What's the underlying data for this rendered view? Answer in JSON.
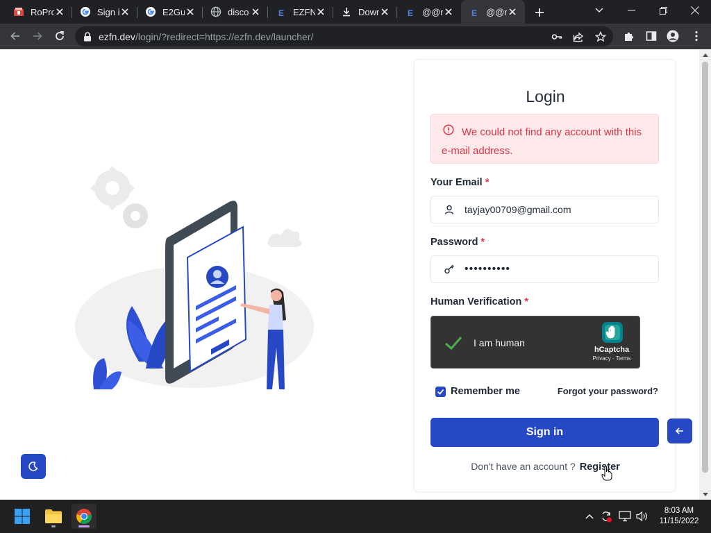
{
  "browser": {
    "tabs": [
      {
        "title": "RoPro",
        "icon": "ropro-icon"
      },
      {
        "title": "Sign i",
        "icon": "google-icon"
      },
      {
        "title": "E2Gu",
        "icon": "google-icon"
      },
      {
        "title": "disco",
        "icon": "globe-icon"
      },
      {
        "title": "EZFN",
        "icon": "ezfn-icon"
      },
      {
        "title": "Down",
        "icon": "download-icon"
      },
      {
        "title": "@@n",
        "icon": "ezfn-icon"
      },
      {
        "title": "@@n",
        "icon": "ezfn-icon",
        "active": true
      }
    ],
    "url_host": "ezfn.dev",
    "url_path": "/login/?redirect=https://ezfn.dev/launcher/"
  },
  "login": {
    "title": "Login",
    "alert": "We could not find any account with this e-mail address.",
    "email_label": "Your Email",
    "email_value": "tayjay00709@gmail.com",
    "password_label": "Password",
    "password_value": "••••••••••",
    "captcha_label": "Human Verification",
    "captcha_text": "I am human",
    "captcha_brand": "hCaptcha",
    "captcha_links": "Privacy - Terms",
    "required_mark": "*",
    "remember_label": "Remember me",
    "remember_checked": true,
    "forgot_label": "Forgot your password?",
    "signin_label": "Sign in",
    "no_account_text": "Don't have an account ?",
    "register_label": "Register"
  },
  "colors": {
    "primary": "#2748c4",
    "alert_bg": "#fde8ea",
    "alert_text": "#dc3545",
    "captcha_bg": "#333333",
    "captcha_logo": "#00838f"
  },
  "taskbar": {
    "time": "8:03 AM",
    "date": "11/15/2022",
    "apps": [
      "windows-start-icon",
      "file-explorer-icon",
      "chrome-icon"
    ]
  }
}
